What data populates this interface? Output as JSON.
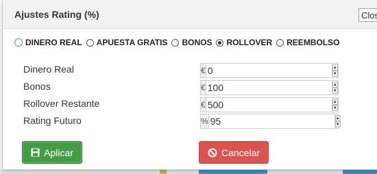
{
  "dialog": {
    "title": "Ajustes Rating (%)",
    "close_label": "Close"
  },
  "radio_options": [
    {
      "label": "DINERO REAL",
      "checked": false
    },
    {
      "label": "APUESTA GRATIS",
      "checked": false
    },
    {
      "label": "BONOS",
      "checked": false
    },
    {
      "label": "ROLLOVER",
      "checked": true
    },
    {
      "label": "REEMBOLSO",
      "checked": false
    }
  ],
  "fields": [
    {
      "label": "Dinero Real",
      "addon": "€",
      "value": "0"
    },
    {
      "label": "Bonos",
      "addon": "€",
      "value": "100"
    },
    {
      "label": "Rollover Restante",
      "addon": "€",
      "value": "500"
    },
    {
      "label": "Rating Futuro",
      "addon": "%",
      "value": "95"
    }
  ],
  "buttons": {
    "apply": {
      "label": "Aplicar",
      "icon": "floppy-disk-icon",
      "color": "#449d44"
    },
    "cancel": {
      "label": "Cancelar",
      "icon": "ban-icon",
      "color": "#d9534f"
    }
  },
  "spinner": {
    "up": "▲",
    "down": "▼"
  }
}
